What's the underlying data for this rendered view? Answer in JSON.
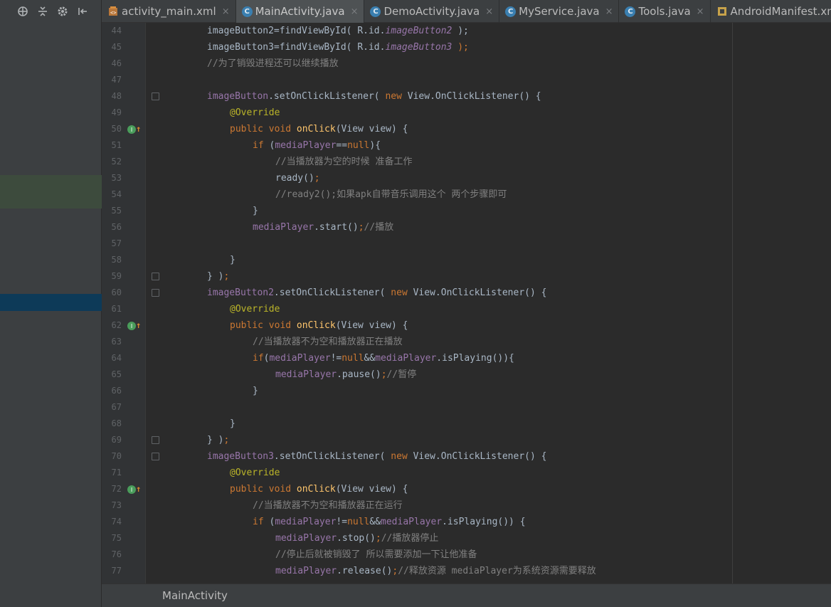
{
  "tabs": [
    {
      "label": "activity_main.xml",
      "icon": "xml-layout-icon",
      "active": false
    },
    {
      "label": "MainActivity.java",
      "icon": "class-icon",
      "active": true
    },
    {
      "label": "DemoActivity.java",
      "icon": "class-icon",
      "active": false
    },
    {
      "label": "MyService.java",
      "icon": "class-icon",
      "active": false
    },
    {
      "label": "Tools.java",
      "icon": "class-icon",
      "active": false
    },
    {
      "label": "AndroidManifest.xm",
      "icon": "manifest-icon",
      "active": false
    }
  ],
  "tab_close_glyph": "×",
  "class_icon_letter": "C",
  "status_bar": {
    "breadcrumb": "MainActivity"
  },
  "code_lines": [
    {
      "n": "44",
      "segs": [
        [
          "imageButton2=findViewById( R.id.",
          "txt"
        ],
        [
          "imageButton2",
          "ital"
        ],
        [
          " );",
          "txt"
        ]
      ]
    },
    {
      "n": "45",
      "segs": [
        [
          "imageButton3=findViewById( R.id.",
          "txt"
        ],
        [
          "imageButton3",
          "ital"
        ],
        [
          " );",
          "kwend"
        ]
      ]
    },
    {
      "n": "46",
      "segs": [
        [
          "//为了销毁进程还可以继续播放",
          "cmt"
        ]
      ]
    },
    {
      "n": "47",
      "segs": []
    },
    {
      "n": "48",
      "segs": [
        [
          "imageButton",
          "field"
        ],
        [
          ".setOnClickListener( ",
          "txt"
        ],
        [
          "new ",
          "kw"
        ],
        [
          "View.OnClickListener() {",
          "txt"
        ]
      ]
    },
    {
      "n": "49",
      "segs": [
        [
          "@Override",
          "ann"
        ]
      ]
    },
    {
      "n": "50",
      "segs": [
        [
          "public void ",
          "kw"
        ],
        [
          "onClick",
          "fn"
        ],
        [
          "(View view) {",
          "txt"
        ]
      ]
    },
    {
      "n": "51",
      "segs": [
        [
          "if ",
          "kw"
        ],
        [
          "(",
          "txt"
        ],
        [
          "mediaPlayer",
          "field"
        ],
        [
          "==",
          "txt"
        ],
        [
          "null",
          "kw"
        ],
        [
          "){",
          "txt"
        ]
      ]
    },
    {
      "n": "52",
      "segs": [
        [
          "//当播放器为空的时候 准备工作",
          "cmt"
        ]
      ]
    },
    {
      "n": "53",
      "segs": [
        [
          "ready()",
          "txt"
        ],
        [
          ";",
          "kw"
        ]
      ]
    },
    {
      "n": "54",
      "segs": [
        [
          "//ready2();如果apk自带音乐调用这个 两个步骤即可",
          "cmt"
        ]
      ]
    },
    {
      "n": "55",
      "segs": [
        [
          "}",
          "txt"
        ]
      ]
    },
    {
      "n": "56",
      "segs": [
        [
          "mediaPlayer",
          "field"
        ],
        [
          ".start()",
          "txt"
        ],
        [
          ";",
          "kw"
        ],
        [
          "//播放",
          "cmt"
        ]
      ]
    },
    {
      "n": "57",
      "segs": []
    },
    {
      "n": "58",
      "segs": [
        [
          "}",
          "txt"
        ]
      ]
    },
    {
      "n": "59",
      "segs": [
        [
          "} )",
          "txt"
        ],
        [
          ";",
          "kw"
        ]
      ]
    },
    {
      "n": "60",
      "segs": [
        [
          "imageButton2",
          "field"
        ],
        [
          ".setOnClickListener( ",
          "txt"
        ],
        [
          "new ",
          "kw"
        ],
        [
          "View.OnClickListener() {",
          "txt"
        ]
      ]
    },
    {
      "n": "61",
      "segs": [
        [
          "@Override",
          "ann"
        ]
      ]
    },
    {
      "n": "62",
      "segs": [
        [
          "public void ",
          "kw"
        ],
        [
          "onClick",
          "fn"
        ],
        [
          "(View view) {",
          "txt"
        ]
      ]
    },
    {
      "n": "63",
      "segs": [
        [
          "//当播放器不为空和播放器正在播放",
          "cmt"
        ]
      ]
    },
    {
      "n": "64",
      "segs": [
        [
          "if",
          "kw"
        ],
        [
          "(",
          "txt"
        ],
        [
          "mediaPlayer",
          "field"
        ],
        [
          "!=",
          "txt"
        ],
        [
          "null",
          "kw"
        ],
        [
          "&&",
          "txt"
        ],
        [
          "mediaPlayer",
          "field"
        ],
        [
          ".isPlaying()){",
          "txt"
        ]
      ]
    },
    {
      "n": "65",
      "segs": [
        [
          "mediaPlayer",
          "field"
        ],
        [
          ".pause()",
          "txt"
        ],
        [
          ";",
          "kw"
        ],
        [
          "//暂停",
          "cmt"
        ]
      ]
    },
    {
      "n": "66",
      "segs": [
        [
          "}",
          "txt"
        ]
      ]
    },
    {
      "n": "67",
      "segs": []
    },
    {
      "n": "68",
      "segs": [
        [
          "}",
          "txt"
        ]
      ]
    },
    {
      "n": "69",
      "segs": [
        [
          "} )",
          "txt"
        ],
        [
          ";",
          "kw"
        ]
      ]
    },
    {
      "n": "70",
      "segs": [
        [
          "imageButton3",
          "field"
        ],
        [
          ".setOnClickListener( ",
          "txt"
        ],
        [
          "new ",
          "kw"
        ],
        [
          "View.OnClickListener() {",
          "txt"
        ]
      ]
    },
    {
      "n": "71",
      "segs": [
        [
          "@Override",
          "ann"
        ]
      ]
    },
    {
      "n": "72",
      "segs": [
        [
          "public void ",
          "kw"
        ],
        [
          "onClick",
          "fn"
        ],
        [
          "(View view) {",
          "txt"
        ]
      ]
    },
    {
      "n": "73",
      "segs": [
        [
          "//当播放器不为空和播放器正在运行",
          "cmt"
        ]
      ]
    },
    {
      "n": "74",
      "segs": [
        [
          "if ",
          "kw"
        ],
        [
          "(",
          "txt"
        ],
        [
          "mediaPlayer",
          "field"
        ],
        [
          "!=",
          "txt"
        ],
        [
          "null",
          "kw"
        ],
        [
          "&&",
          "txt"
        ],
        [
          "mediaPlayer",
          "field"
        ],
        [
          ".isPlaying()) {",
          "txt"
        ]
      ]
    },
    {
      "n": "75",
      "segs": [
        [
          "mediaPlayer",
          "field"
        ],
        [
          ".stop()",
          "txt"
        ],
        [
          ";",
          "kw"
        ],
        [
          "//播放器停止",
          "cmt"
        ]
      ]
    },
    {
      "n": "76",
      "segs": [
        [
          "//停止后就被销毁了 所以需要添加一下让他准备",
          "cmt"
        ]
      ]
    },
    {
      "n": "77",
      "segs": [
        [
          "mediaPlayer",
          "field"
        ],
        [
          ".release()",
          "txt"
        ],
        [
          ";",
          "kw"
        ],
        [
          "//释放资源 mediaPlayer为系统资源需要释放",
          "cmt"
        ]
      ]
    }
  ],
  "colors": {
    "editor_bg": "#2b2b2b",
    "panel_bg": "#3c3f41",
    "keyword": "#cc7832",
    "field": "#9876aa",
    "comment": "#808080",
    "annotation": "#bbb529",
    "method": "#ffc66d",
    "text": "#a9b7c6"
  }
}
